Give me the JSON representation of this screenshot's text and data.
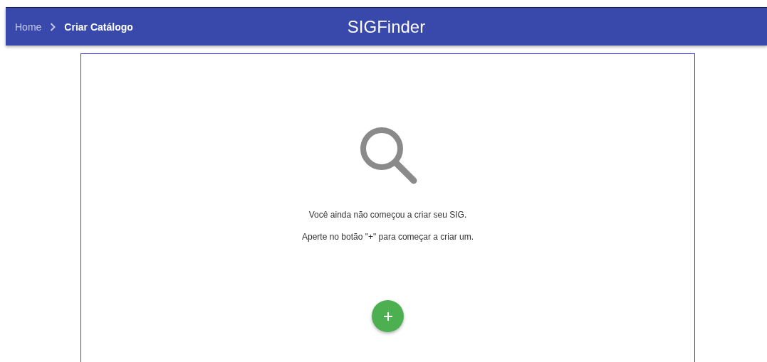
{
  "header": {
    "breadcrumbs": [
      {
        "label": "Home",
        "selected": false
      },
      {
        "label": "Criar Catálogo",
        "selected": true
      }
    ],
    "title": "SIGFinder"
  },
  "empty_state": {
    "messages": [
      "Você ainda não começou a criar seu SIG.",
      "Aperte no botão \"+\" para começar a criar um."
    ]
  }
}
